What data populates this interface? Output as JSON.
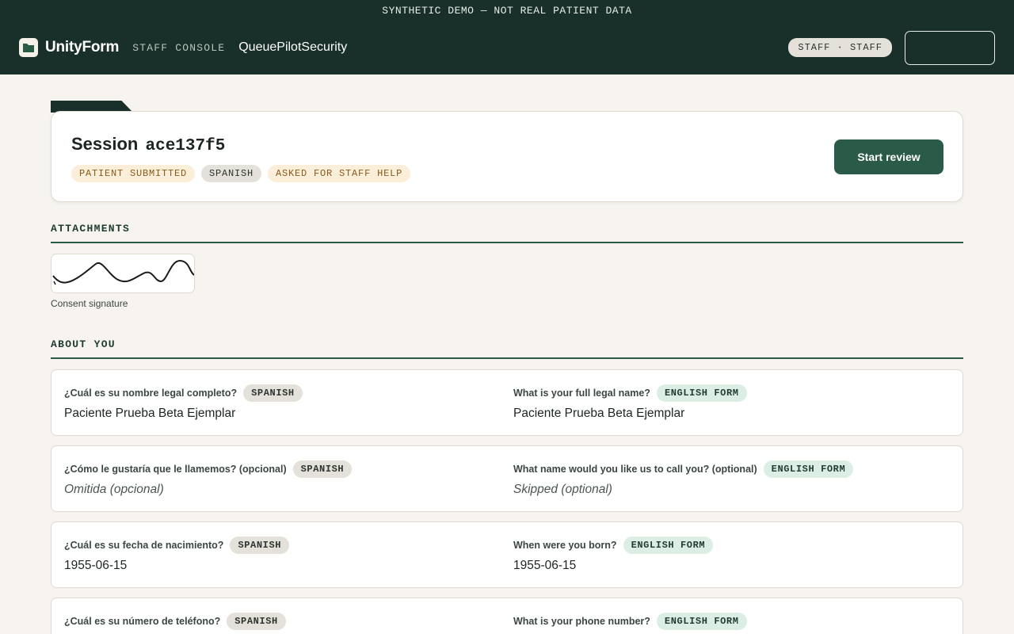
{
  "banner": {
    "text": "SYNTHETIC DEMO — NOT REAL PATIENT DATA"
  },
  "header": {
    "brand": "UnityForm",
    "console_label": "STAFF CONSOLE",
    "org_name": "QueuePilotSecurity",
    "role_pill": "STAFF · STAFF",
    "logo_icon": "folder-icon"
  },
  "session": {
    "title_prefix": "Session",
    "id": "ace137f5",
    "badges": [
      "PATIENT SUBMITTED",
      "SPANISH",
      "ASKED FOR STAFF HELP"
    ],
    "start_button": "Start review"
  },
  "attachments": {
    "heading": "ATTACHMENTS",
    "items": [
      {
        "caption": "Consent signature"
      }
    ]
  },
  "about": {
    "heading": "ABOUT YOU",
    "questions": [
      {
        "q_es": "¿Cuál es su nombre legal completo?",
        "tag_es": "SPANISH",
        "a_es": "Paciente Prueba Beta Ejemplar",
        "q_en": "What is your full legal name?",
        "tag_en": "ENGLISH FORM",
        "a_en": "Paciente Prueba Beta Ejemplar"
      },
      {
        "q_es": "¿Cómo le gustaría que le llamemos? (opcional)",
        "tag_es": "SPANISH",
        "a_es": "Omitida (opcional)",
        "q_en": "What name would you like us to call you? (optional)",
        "tag_en": "ENGLISH FORM",
        "a_en": "Skipped (optional)"
      },
      {
        "q_es": "¿Cuál es su fecha de nacimiento?",
        "tag_es": "SPANISH",
        "a_es": "1955-06-15",
        "q_en": "When were you born?",
        "tag_en": "ENGLISH FORM",
        "a_en": "1955-06-15"
      },
      {
        "q_es": "¿Cuál es su número de teléfono?",
        "tag_es": "SPANISH",
        "a_es": "",
        "q_en": "What is your phone number?",
        "tag_en": "ENGLISH FORM",
        "a_en": ""
      }
    ]
  },
  "colors": {
    "header_bg": "#19302a",
    "accent": "#2a5a48",
    "page_bg": "#f7f4ef",
    "amber_badge": "#fbefd9",
    "english_tag": "#dceee4"
  }
}
